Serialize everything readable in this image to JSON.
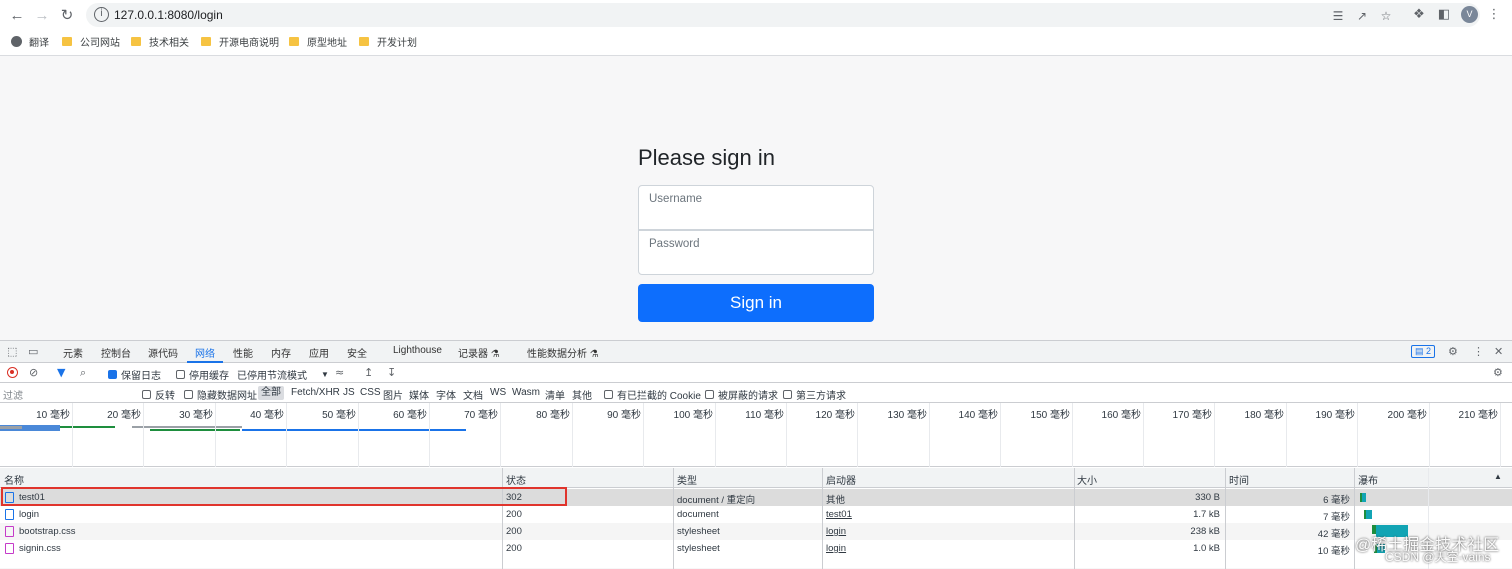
{
  "browser": {
    "url": "127.0.0.1:8080/login",
    "avatar_letter": "V",
    "bookmarks": [
      {
        "label": "翻译",
        "icon": "globe-icon"
      },
      {
        "label": "公司网站",
        "icon": "folder-icon"
      },
      {
        "label": "技术相关",
        "icon": "folder-icon"
      },
      {
        "label": "开源电商说明",
        "icon": "folder-icon"
      },
      {
        "label": "原型地址",
        "icon": "folder-icon"
      },
      {
        "label": "开发计划",
        "icon": "folder-icon"
      }
    ]
  },
  "page": {
    "title": "Please sign in",
    "username_placeholder": "Username",
    "password_placeholder": "Password",
    "signin_label": "Sign in",
    "accent": "#0d6efd"
  },
  "devtools": {
    "tabs": [
      "元素",
      "控制台",
      "源代码",
      "网络",
      "性能",
      "内存",
      "应用",
      "安全",
      "Lighthouse",
      "记录器 ⚗",
      "性能数据分析 ⚗"
    ],
    "active_tab": "网络",
    "issues_badge": "2",
    "toolbar": {
      "preserve_log": "保留日志",
      "disable_cache": "停用缓存",
      "throttle": "已停用节流模式"
    },
    "filter": {
      "placeholder": "过滤",
      "invert": "反转",
      "hide_data_urls": "隐藏数据网址",
      "types": [
        "全部",
        "Fetch/XHR",
        "JS",
        "CSS",
        "图片",
        "媒体",
        "字体",
        "文档",
        "WS",
        "Wasm",
        "清单",
        "其他"
      ],
      "blocked_cookies": "有已拦截的 Cookie",
      "blocked_requests": "被屏蔽的请求",
      "third_party": "第三方请求"
    },
    "timeline_ticks": [
      "10 毫秒",
      "20 毫秒",
      "30 毫秒",
      "40 毫秒",
      "50 毫秒",
      "60 毫秒",
      "70 毫秒",
      "80 毫秒",
      "90 毫秒",
      "100 毫秒",
      "110 毫秒",
      "120 毫秒",
      "130 毫秒",
      "140 毫秒",
      "150 毫秒",
      "160 毫秒",
      "170 毫秒",
      "180 毫秒",
      "190 毫秒",
      "200 毫秒",
      "210 毫秒"
    ],
    "columns": [
      "名称",
      "状态",
      "类型",
      "启动器",
      "大小",
      "时间",
      "瀑布"
    ],
    "rows": [
      {
        "name": "test01",
        "status": "302",
        "type": "document / 重定向",
        "initiator": "其他",
        "size": "330 B",
        "time": "6 毫秒",
        "file_kind": "document"
      },
      {
        "name": "login",
        "status": "200",
        "type": "document",
        "initiator": "test01",
        "size": "1.7 kB",
        "time": "7 毫秒",
        "file_kind": "document"
      },
      {
        "name": "bootstrap.css",
        "status": "200",
        "type": "stylesheet",
        "initiator": "login",
        "size": "238 kB",
        "time": "42 毫秒",
        "file_kind": "css"
      },
      {
        "name": "signin.css",
        "status": "200",
        "type": "stylesheet",
        "initiator": "login",
        "size": "1.0 kB",
        "time": "10 毫秒",
        "file_kind": "css"
      }
    ]
  },
  "watermark": {
    "line1": "@稀土掘金技术社区",
    "line2": "CSDN @天空-vains"
  }
}
